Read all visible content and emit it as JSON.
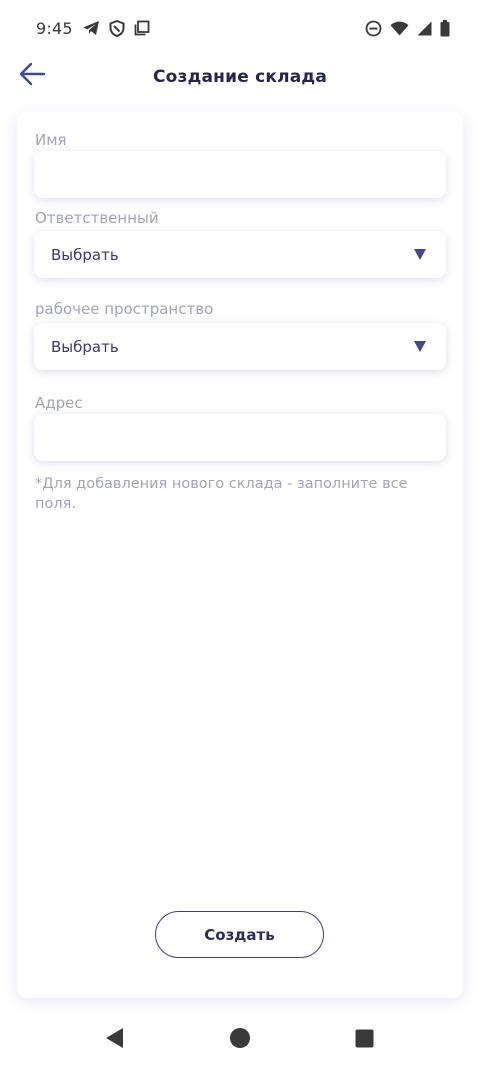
{
  "status_bar": {
    "time": "9:45",
    "icons_left": [
      "telegram-icon",
      "vpn-shield-icon",
      "copy-icon"
    ],
    "icons_right": [
      "do-not-disturb-icon",
      "wifi-icon",
      "signal-icon",
      "battery-icon"
    ]
  },
  "header": {
    "title": "Создание склада",
    "back_icon": "arrow-left-icon"
  },
  "form": {
    "name_label": "Имя",
    "name_value": "",
    "responsible_label": "Ответственный",
    "responsible_value": "Выбрать",
    "workspace_label": "рабочее пространство",
    "workspace_value": "Выбрать",
    "address_label": "Адрес",
    "address_value": "",
    "hint": "*Для добавления нового склада - заполните все поля.",
    "submit_label": "Создать"
  },
  "nav_bar": {
    "buttons": [
      "back-triangle-icon",
      "home-circle-icon",
      "recents-square-icon"
    ]
  },
  "colors": {
    "accent": "#3f4a8e",
    "title": "#232750",
    "label": "#a2a4bb"
  }
}
